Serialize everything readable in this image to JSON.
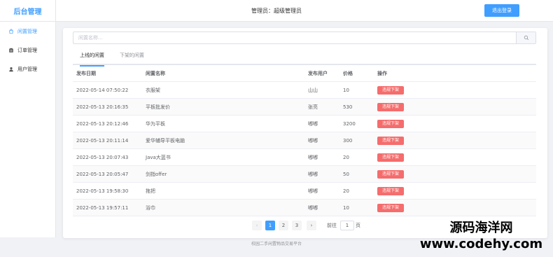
{
  "header": {
    "logo": "后台管理",
    "admin": "管理员：超级管理员",
    "logout": "退出登录"
  },
  "sidebar": {
    "items": [
      {
        "label": "闲置管理",
        "icon": "bag-icon",
        "active": true
      },
      {
        "label": "订单管理",
        "icon": "list-icon",
        "active": false
      },
      {
        "label": "用户管理",
        "icon": "user-icon",
        "active": false
      }
    ]
  },
  "search": {
    "placeholder": "闲置名称..."
  },
  "tabs": [
    {
      "label": "上线的闲置",
      "active": true
    },
    {
      "label": "下架的闲置",
      "active": false
    }
  ],
  "table": {
    "headers": [
      "发布日期",
      "闲置名称",
      "发布用户",
      "价格",
      "操作"
    ],
    "rows": [
      {
        "date": "2022-05-14 07:50:22",
        "name": "衣服架",
        "user": "山山",
        "price": "10",
        "action": "违规下架"
      },
      {
        "date": "2022-05-13 20:16:35",
        "name": "平板批发价",
        "user": "张亮",
        "price": "530",
        "action": "违规下架"
      },
      {
        "date": "2022-05-13 20:12:46",
        "name": "华为平板",
        "user": "嘟嘟",
        "price": "3200",
        "action": "违规下架"
      },
      {
        "date": "2022-05-13 20:11:14",
        "name": "爱华辅导平板电脑",
        "user": "嘟嘟",
        "price": "300",
        "action": "违规下架"
      },
      {
        "date": "2022-05-13 20:07:43",
        "name": "Java大蓝书",
        "user": "嘟嘟",
        "price": "20",
        "action": "违规下架"
      },
      {
        "date": "2022-05-13 20:05:47",
        "name": "剑指offer",
        "user": "嘟嘟",
        "price": "50",
        "action": "违规下架"
      },
      {
        "date": "2022-05-13 19:58:30",
        "name": "拖把",
        "user": "嘟嘟",
        "price": "20",
        "action": "违规下架"
      },
      {
        "date": "2022-05-13 19:57:11",
        "name": "浴巾",
        "user": "嘟嘟",
        "price": "10",
        "action": "违规下架"
      }
    ]
  },
  "pagination": {
    "prev": "‹",
    "pages": [
      "1",
      "2",
      "3"
    ],
    "current": "1",
    "next": "›",
    "goto_label": "前往",
    "goto_value": "1",
    "goto_suffix": "页"
  },
  "footer": "校园二手闲置物品交易平台",
  "watermark": {
    "line1": "源码海洋网",
    "line2": "www.codehy.com"
  },
  "colors": {
    "primary": "#409eff",
    "danger": "#f56c6c"
  }
}
